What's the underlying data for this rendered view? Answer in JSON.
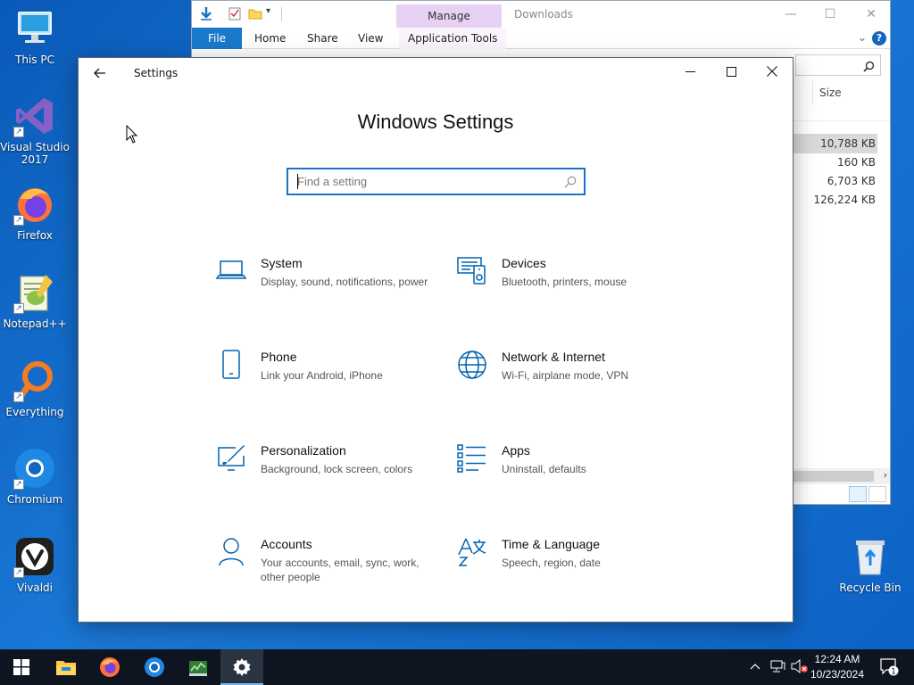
{
  "desktop": {
    "icons": [
      {
        "label": "This PC",
        "icon": "this-pc-icon"
      },
      {
        "label": "Visual Studio 2017",
        "icon": "visual-studio-icon"
      },
      {
        "label": "Firefox",
        "icon": "firefox-icon"
      },
      {
        "label": "Notepad++",
        "icon": "notepadpp-icon"
      },
      {
        "label": "Everything",
        "icon": "everything-icon"
      },
      {
        "label": "Chromium",
        "icon": "chromium-icon"
      },
      {
        "label": "Vivaldi",
        "icon": "vivaldi-icon"
      }
    ],
    "recycle_bin": "Recycle Bin"
  },
  "explorer": {
    "title": "Downloads",
    "context_tab": "Manage",
    "ribbon_tabs": [
      "File",
      "Home",
      "Share",
      "View",
      "Application Tools"
    ],
    "column_size": "Size",
    "sizes": [
      "10,788 KB",
      "160 KB",
      "6,703 KB",
      "126,224 KB"
    ],
    "help": "?"
  },
  "settings": {
    "window_title": "Settings",
    "heading": "Windows Settings",
    "search_placeholder": "Find a setting",
    "categories": [
      {
        "title": "System",
        "desc": "Display, sound, notifications, power",
        "icon": "laptop-icon"
      },
      {
        "title": "Devices",
        "desc": "Bluetooth, printers, mouse",
        "icon": "devices-icon"
      },
      {
        "title": "Phone",
        "desc": "Link your Android, iPhone",
        "icon": "phone-icon"
      },
      {
        "title": "Network & Internet",
        "desc": "Wi-Fi, airplane mode, VPN",
        "icon": "globe-icon"
      },
      {
        "title": "Personalization",
        "desc": "Background, lock screen, colors",
        "icon": "personalization-icon"
      },
      {
        "title": "Apps",
        "desc": "Uninstall, defaults",
        "icon": "apps-list-icon"
      },
      {
        "title": "Accounts",
        "desc": "Your accounts, email, sync, work, other people",
        "icon": "person-icon"
      },
      {
        "title": "Time & Language",
        "desc": "Speech, region, date",
        "icon": "time-language-icon"
      }
    ]
  },
  "taskbar": {
    "time": "12:24 AM",
    "date": "10/23/2024",
    "notification_count": "1"
  },
  "colors": {
    "accent": "#0063b1",
    "desktop": "#1a78d6",
    "taskbar": "#0e1520"
  }
}
